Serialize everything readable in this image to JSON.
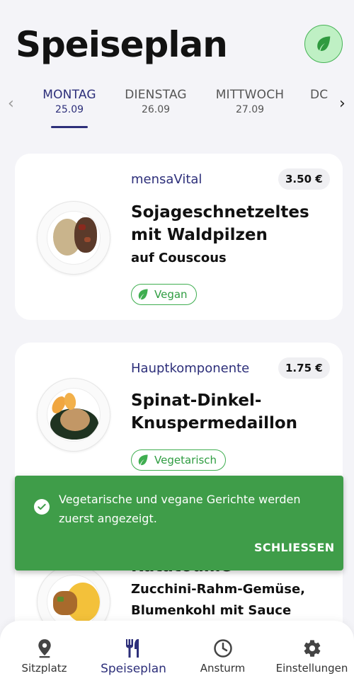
{
  "header": {
    "title": "Speiseplan",
    "filter_icon": "leaf-icon"
  },
  "day_tabs": [
    {
      "day": "MONTAG",
      "date": "25.09",
      "active": true
    },
    {
      "day": "DIENSTAG",
      "date": "26.09",
      "active": false
    },
    {
      "day": "MITTWOCH",
      "date": "27.09",
      "active": false
    },
    {
      "day": "DC",
      "date": "",
      "active": false
    }
  ],
  "meals": [
    {
      "category": "mensaVital",
      "price": "3.50 €",
      "name": "Sojageschnetzeltes mit Waldpilzen",
      "side": "auf Couscous",
      "badge": "Vegan"
    },
    {
      "category": "Hauptkomponente",
      "price": "1.75 €",
      "name": "Spinat-Dinkel-Knuspermedaillon",
      "side": "",
      "badge": "Vegetarisch"
    },
    {
      "category": "",
      "price": "",
      "name": "Ratatouille",
      "side": "Zucchini-Rahm-Gemüse, Blumenkohl mit Sauce",
      "badge": ""
    }
  ],
  "snackbar": {
    "message": "Vegetarische und vegane Gerichte werden zuerst angezeigt.",
    "action": "SCHLIESSEN"
  },
  "bottom_nav": [
    {
      "label": "Sitzplatz",
      "icon": "location-pin-icon",
      "active": false
    },
    {
      "label": "Speiseplan",
      "icon": "fork-knife-icon",
      "active": true
    },
    {
      "label": "Ansturm",
      "icon": "clock-icon",
      "active": false
    },
    {
      "label": "Einstellungen",
      "icon": "gear-icon",
      "active": false
    }
  ],
  "colors": {
    "accent": "#2d2f7a",
    "green": "#3f9d49",
    "leaf_bg": "#bff0c4"
  }
}
